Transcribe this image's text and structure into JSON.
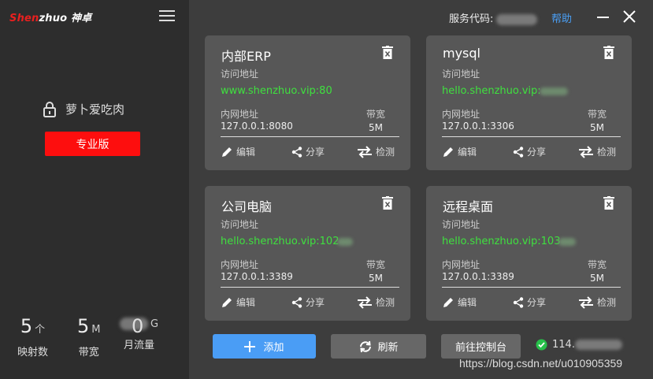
{
  "brand": {
    "logo_part1": "Shen",
    "logo_part2": "zhuo",
    "logo_cn": "神卓"
  },
  "user": {
    "name": "萝卜爱吃肉",
    "plan_button": "专业版"
  },
  "stats": [
    {
      "num": "5",
      "unit": "个",
      "label": "映射数"
    },
    {
      "num": "5",
      "unit": "M",
      "label": "带宽"
    },
    {
      "num": "0",
      "unit": "G",
      "label": "月流量"
    }
  ],
  "topbar": {
    "service_label": "服务代码:",
    "help": "帮助"
  },
  "common": {
    "access_label": "访问地址",
    "intranet_label": "内网地址",
    "bandwidth_label": "带宽",
    "edit": "编辑",
    "share": "分享",
    "check": "检测"
  },
  "cards": [
    {
      "title": "内部ERP",
      "url": "www.shenzhuo.vip:80",
      "intranet": "127.0.0.1:8080",
      "bandwidth": "5M"
    },
    {
      "title": "mysql",
      "url": "hello.shenzhuo.vip:",
      "intranet": "127.0.0.1:3306",
      "bandwidth": "5M"
    },
    {
      "title": "公司电脑",
      "url": "hello.shenzhuo.vip:102",
      "intranet": "127.0.0.1:3389",
      "bandwidth": "5M"
    },
    {
      "title": "远程桌面",
      "url": "hello.shenzhuo.vip:103",
      "intranet": "127.0.0.1:3389",
      "bandwidth": "5M"
    }
  ],
  "buttons": {
    "add": "添加",
    "refresh": "刷新",
    "console": "前往控制台"
  },
  "status": {
    "ip": "114."
  },
  "watermark": "https://blog.csdn.net/u010905359",
  "colors": {
    "accent_blue": "#4a9df5",
    "pro_red": "#fd0e0e",
    "url_green": "#3fe03f",
    "status_green": "#27c04a"
  }
}
